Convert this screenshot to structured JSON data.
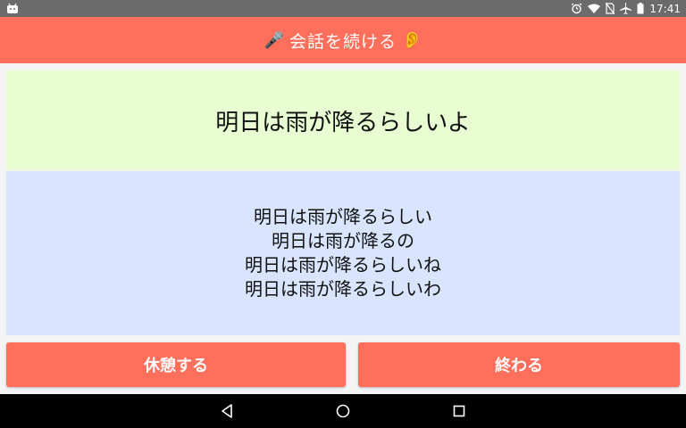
{
  "status_bar": {
    "time": "17:41",
    "icons": [
      "android-icon",
      "alarm-icon",
      "wifi-icon",
      "no-sim-icon",
      "airplane-icon",
      "battery-icon"
    ]
  },
  "app_bar": {
    "title": "会話を続ける",
    "left_emoji": "🎤",
    "right_emoji": "👂"
  },
  "prompt": {
    "text": "明日は雨が降るらしいよ"
  },
  "candidates": [
    "明日は雨が降るらしい",
    "明日は雨が降るの",
    "明日は雨が降るらしいね",
    "明日は雨が降るらしいわ"
  ],
  "buttons": {
    "rest_label": "休憩する",
    "end_label": "終わる"
  },
  "colors": {
    "accent": "#ff6f5b",
    "prompt_bg": "#e9fdd3",
    "candidates_bg": "#d9e5ff"
  },
  "nav_bar": {
    "icons": [
      "back-icon",
      "home-icon",
      "recents-icon"
    ]
  }
}
